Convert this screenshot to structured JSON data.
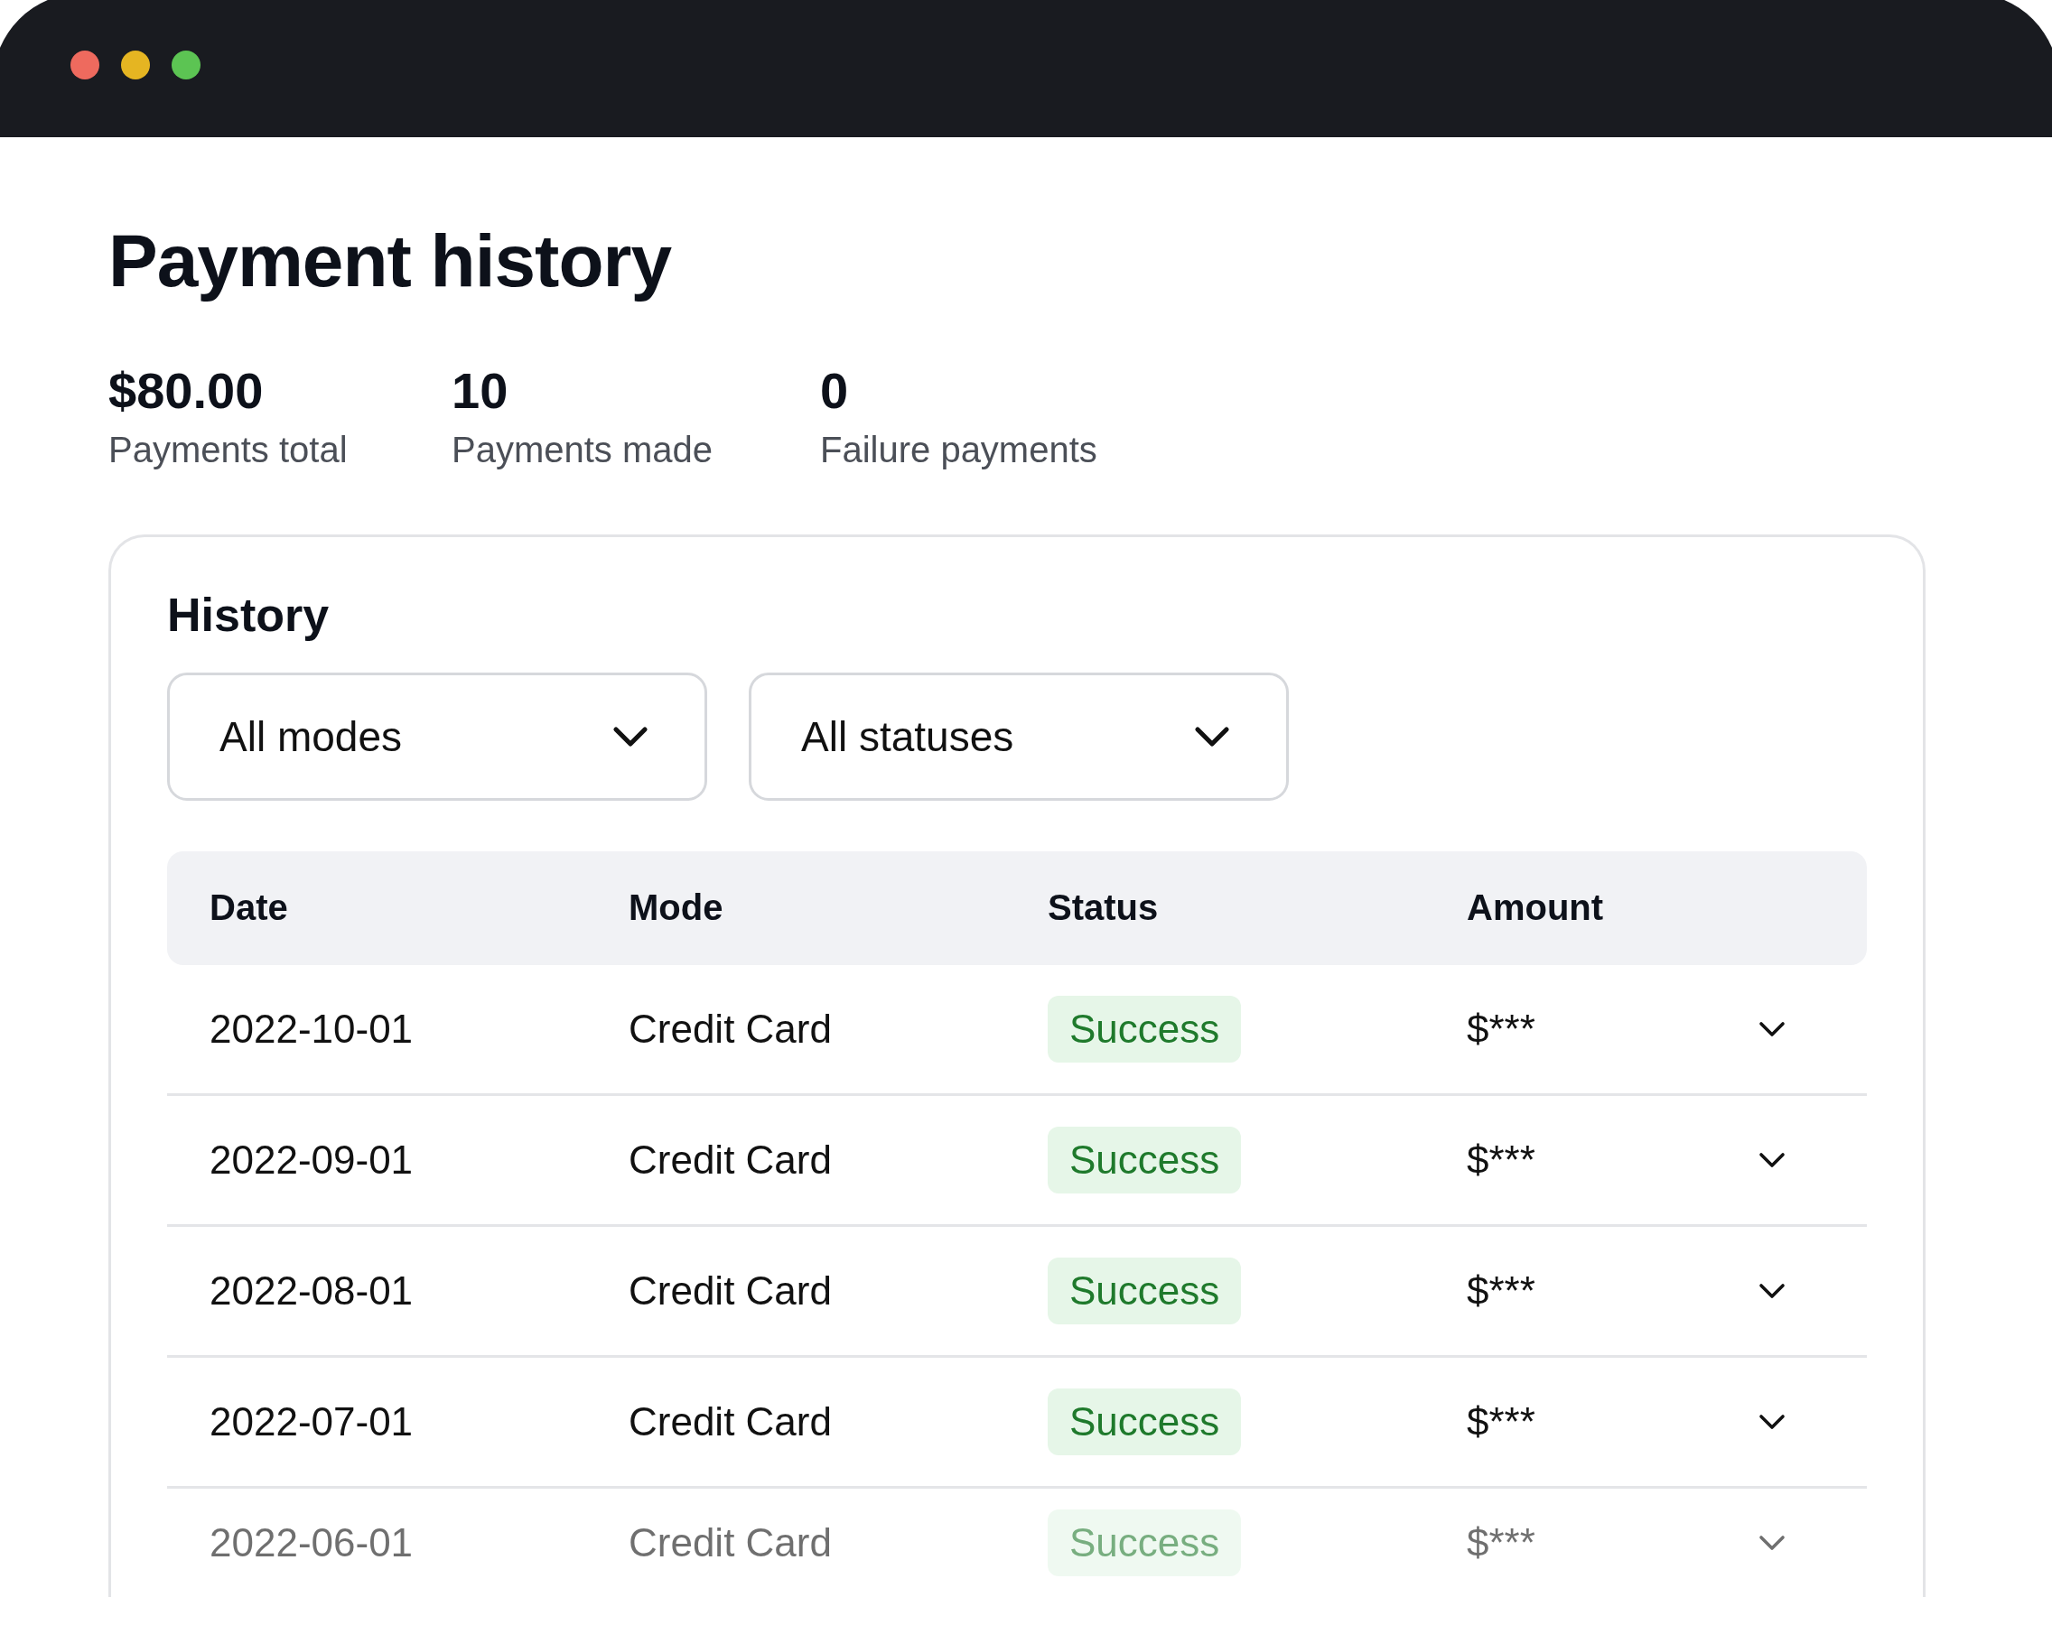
{
  "page": {
    "title": "Payment history"
  },
  "stats": [
    {
      "value": "$80.00",
      "label": "Payments total"
    },
    {
      "value": "10",
      "label": "Payments made"
    },
    {
      "value": "0",
      "label": "Failure payments"
    }
  ],
  "history": {
    "title": "History",
    "filters": [
      {
        "value": "All modes"
      },
      {
        "value": "All statuses"
      }
    ],
    "table": {
      "columns": [
        "Date",
        "Mode",
        "Status",
        "Amount"
      ],
      "rows": [
        {
          "date": "2022-10-01",
          "mode": "Credit Card",
          "status": "Success",
          "amount": "$***"
        },
        {
          "date": "2022-09-01",
          "mode": "Credit Card",
          "status": "Success",
          "amount": "$***"
        },
        {
          "date": "2022-08-01",
          "mode": "Credit Card",
          "status": "Success",
          "amount": "$***"
        },
        {
          "date": "2022-07-01",
          "mode": "Credit Card",
          "status": "Success",
          "amount": "$***"
        },
        {
          "date": "2022-06-01",
          "mode": "Credit Card",
          "status": "Success",
          "amount": "$***"
        }
      ]
    }
  }
}
